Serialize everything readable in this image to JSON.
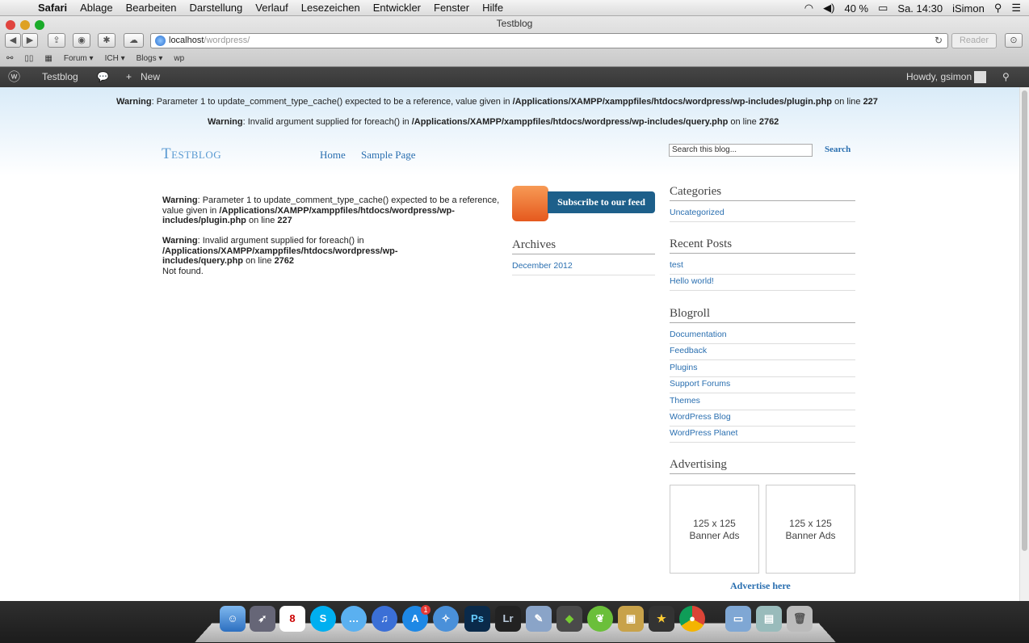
{
  "menubar": {
    "app_name": "Safari",
    "items": [
      "Ablage",
      "Bearbeiten",
      "Darstellung",
      "Verlauf",
      "Lesezeichen",
      "Entwickler",
      "Fenster",
      "Hilfe"
    ],
    "battery": "40 %",
    "clock": "Sa. 14:30",
    "user": "iSimon"
  },
  "browser": {
    "window_title": "Testblog",
    "url_host": "localhost",
    "url_path": "/wordpress/",
    "reader_label": "Reader",
    "bookmarks": [
      "Forum ▾",
      "ICH ▾",
      "Blogs ▾",
      "wp"
    ]
  },
  "adminbar": {
    "site_name": "Testblog",
    "new_label": "New",
    "howdy": "Howdy, gsimon"
  },
  "top_warnings": [
    {
      "label": "Warning",
      "text": ": Parameter 1 to update_comment_type_cache() expected to be a reference, value given in ",
      "path": "/Applications/XAMPP/xamppfiles/htdocs/wordpress/wp-includes/plugin.php",
      "online": " on line ",
      "line": "227"
    },
    {
      "label": "Warning",
      "text": ": Invalid argument supplied for foreach() in ",
      "path": "/Applications/XAMPP/xamppfiles/htdocs/wordpress/wp-includes/query.php",
      "online": " on line ",
      "line": "2762"
    }
  ],
  "header": {
    "blog_title": "Testblog",
    "nav": [
      "Home",
      "Sample Page"
    ],
    "search_placeholder": "Search this blog...",
    "search_button": "Search"
  },
  "main": {
    "warn1": {
      "label": "Warning",
      "text1": ": Parameter 1 to update_comment_type_cache() expected to be a reference,",
      "text2": "value given in ",
      "path1": "/Applications/XAMPP/xamppfiles/htdocs/wordpress/wp-",
      "path2": "includes/plugin.php",
      "online": " on line ",
      "line": "227"
    },
    "warn2": {
      "label": "Warning",
      "text1": ": Invalid argument supplied for foreach() in",
      "path1": "/Applications/XAMPP/xamppfiles/htdocs/wordpress/wp-",
      "path2": "includes/query.php",
      "online": " on line ",
      "line": "2762"
    },
    "not_found": "Not found."
  },
  "sidebar_left": {
    "subscribe_label": "Subscribe to our feed",
    "archives_title": "Archives",
    "archives": [
      "December 2012"
    ]
  },
  "sidebar_right": {
    "categories_title": "Categories",
    "categories": [
      "Uncategorized"
    ],
    "recent_title": "Recent Posts",
    "recent": [
      "test",
      "Hello world!"
    ],
    "blogroll_title": "Blogroll",
    "blogroll": [
      "Documentation",
      "Feedback",
      "Plugins",
      "Support Forums",
      "Themes",
      "WordPress Blog",
      "WordPress Planet"
    ],
    "advertising_title": "Advertising",
    "ad_label_1": "125 x 125",
    "ad_label_2": "Banner Ads",
    "advertise_here": "Advertise here"
  },
  "dock": {
    "calendar_day": "8",
    "badge": "1",
    "photoshop": "Ps",
    "lightroom": "Lr"
  },
  "colors": {
    "link": "#2a6fb0",
    "adminbar": "#464646",
    "rss": "#e5591e",
    "subscribe": "#1d5f8a"
  }
}
